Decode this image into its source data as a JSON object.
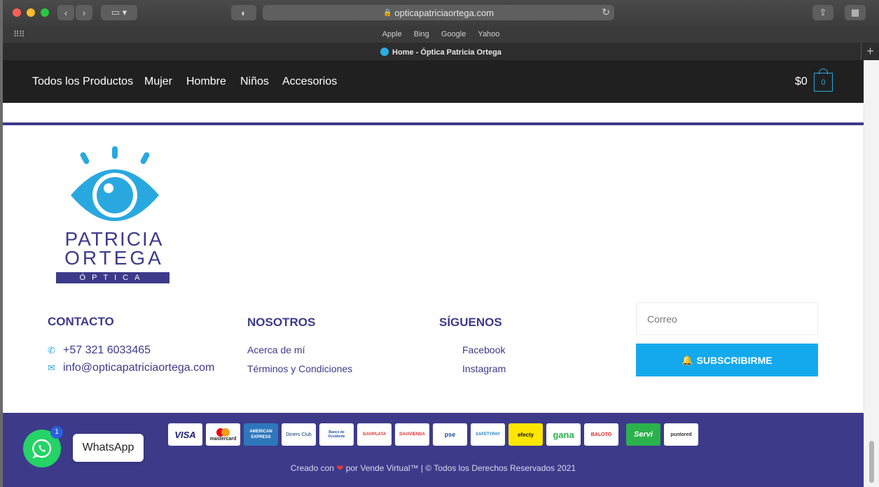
{
  "browser": {
    "url": "opticapatriciaortega.com",
    "favorites": [
      "Apple",
      "Bing",
      "Google",
      "Yahoo"
    ],
    "tab_title": "Home - Óptica Patricia Ortega"
  },
  "nav": {
    "items": [
      "Todos los Productos",
      "Mujer",
      "Hombre",
      "Niños",
      "Accesorios"
    ],
    "cart_total": "$0",
    "cart_count": "0"
  },
  "logo": {
    "line1": "PATRICIA",
    "line2": "ORTEGA",
    "line3": "ÓPTICA"
  },
  "footer": {
    "contacto": {
      "title": "CONTACTO",
      "phone": "+57 321 6033465",
      "email": "info@opticapatriciaortega.com"
    },
    "nosotros": {
      "title": "NOSOTROS",
      "links": [
        "Acerca de mí",
        "Términos y Condiciones"
      ]
    },
    "siguenos": {
      "title": "SÍGUENOS",
      "links": [
        "Facebook",
        "Instagram"
      ]
    },
    "newsletter": {
      "placeholder": "Correo",
      "button": "SUBSCRIBIRME"
    }
  },
  "payments": [
    "VISA",
    "mastercard",
    "AMERICAN EXPRESS",
    "Diners Club",
    "Banco de Occidente",
    "DAVIPLATA",
    "DAVIVIENDA",
    "pse",
    "SAFETYPAY",
    "efecty",
    "gana",
    "BALOTO",
    "Servi",
    "puntored"
  ],
  "credit": {
    "before": "Creado con",
    "after": "por Vende Virtual™ | © Todos los Derechos Reservados 2021"
  },
  "whatsapp": {
    "label": "WhatsApp",
    "badge": "1"
  },
  "colors": {
    "brand_navy": "#3d3a8a",
    "brand_blue": "#29a8e0",
    "button_blue": "#14a9ec",
    "whatsapp_green": "#25d366"
  }
}
